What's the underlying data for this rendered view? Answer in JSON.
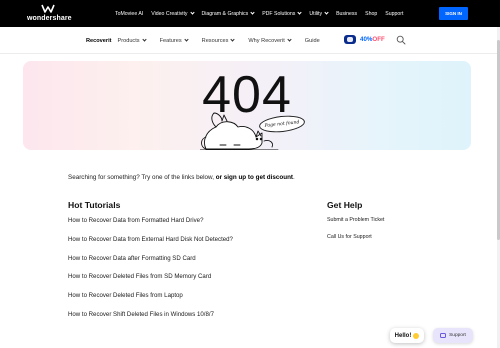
{
  "topbar": {
    "brand": "wondershare",
    "nav": [
      {
        "label": "ToMoviee AI",
        "dropdown": false
      },
      {
        "label": "Video Creativity",
        "dropdown": true
      },
      {
        "label": "Diagram & Graphics",
        "dropdown": true
      },
      {
        "label": "PDF Solutions",
        "dropdown": true
      },
      {
        "label": "Utility",
        "dropdown": true
      },
      {
        "label": "Business",
        "dropdown": false
      },
      {
        "label": "Shop",
        "dropdown": false
      },
      {
        "label": "Support",
        "dropdown": false
      }
    ],
    "signin_label": "SIGN IN"
  },
  "prodbar": {
    "product": "Recoverit",
    "nav": [
      {
        "label": "Products",
        "dropdown": true
      },
      {
        "label": "Features",
        "dropdown": true
      },
      {
        "label": "Resources",
        "dropdown": true
      },
      {
        "label": "Why Recoverit",
        "dropdown": true
      },
      {
        "label": "Guide",
        "dropdown": false
      }
    ],
    "promo_percent": "40%",
    "promo_off": "OFF",
    "search_icon": "search-icon"
  },
  "hero": {
    "code": "404",
    "bubble": "Page not found",
    "colors": {
      "left": "#fde6ee",
      "right": "#def3fb"
    }
  },
  "main": {
    "searching_prefix": "Searching for something? Try one of the links below, ",
    "searching_link": "or sign up to get discount",
    "searching_suffix": ".",
    "tutorials_title": "Hot Tutorials",
    "tutorials": [
      "How to Recover Data from Formatted Hard Drive?",
      "How to Recover Data from External Hard Disk Not Detected?",
      "How to Recover Data after Formatting SD Card",
      "How to Recover Deleted Files from SD Memory Card",
      "How to Recover Deleted Files from Laptop",
      "How to Recover Shift Deleted Files in Windows 10/8/7"
    ],
    "help_title": "Get Help",
    "help": [
      "Submit a Problem Ticket",
      "Call Us for Support"
    ]
  },
  "widgets": {
    "hello": "Hello!",
    "support": "Support"
  },
  "colors": {
    "accent": "#0066ff",
    "promo_off": "#ff4d6d",
    "topbar": "#000000"
  }
}
